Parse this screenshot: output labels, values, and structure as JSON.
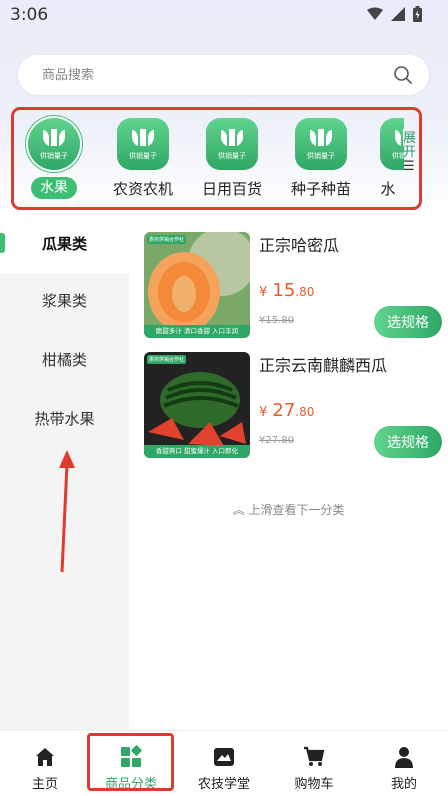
{
  "status_bar": {
    "time": "3:06"
  },
  "search": {
    "placeholder": "商品搜索"
  },
  "categories": [
    {
      "label": "水果",
      "badge": "供销量子",
      "active": true
    },
    {
      "label": "农资农机",
      "badge": "供销量子"
    },
    {
      "label": "日用百货",
      "badge": "供销量子"
    },
    {
      "label": "种子种苗",
      "badge": "供销量子"
    },
    {
      "label": "水",
      "badge": "供销量子"
    }
  ],
  "expand": {
    "label": "展开",
    "icon": "menu-icon"
  },
  "sidebar": {
    "items": [
      {
        "label": "瓜果类",
        "active": true
      },
      {
        "label": "浆果类"
      },
      {
        "label": "柑橘类"
      },
      {
        "label": "热带水果"
      }
    ]
  },
  "products": [
    {
      "name": "正宗哈密瓜",
      "currency": "¥",
      "price_int": "15",
      "price_dec": ".80",
      "old_price": "¥15.80",
      "button": "选规格",
      "image_tag_top": "惠农供销合作社",
      "image_tag_bottom": "脆甜多汁  清口香甜  入口丰润"
    },
    {
      "name": "正宗云南麒麟西瓜",
      "currency": "¥",
      "price_int": "27",
      "price_dec": ".80",
      "old_price": "¥27.80",
      "button": "选规格",
      "image_tag_top": "惠农供销合作社",
      "image_tag_bottom": "香甜爽口  甜蜜爆汁  入口即化"
    }
  ],
  "more_hint": "上滑查看下一分类",
  "bottom_nav": [
    {
      "label": "主页",
      "icon": "home-icon"
    },
    {
      "label": "商品分类",
      "icon": "category-icon",
      "active": true
    },
    {
      "label": "农技学堂",
      "icon": "school-icon"
    },
    {
      "label": "购物车",
      "icon": "cart-icon"
    },
    {
      "label": "我的",
      "icon": "user-icon"
    }
  ],
  "colors": {
    "accent": "#3cbf73",
    "price": "#e8592a",
    "annotation": "#e03a2f"
  }
}
